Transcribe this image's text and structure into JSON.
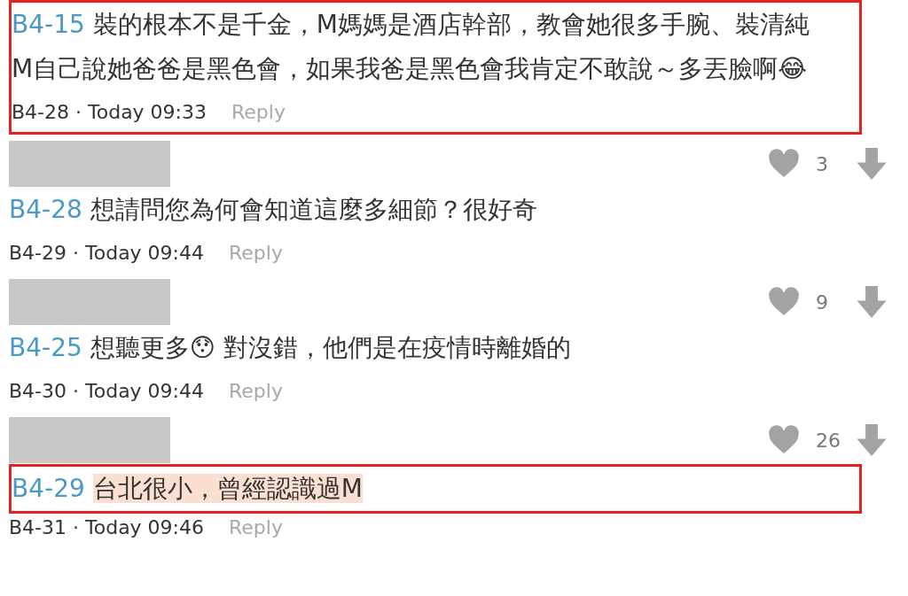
{
  "comments": [
    {
      "kind": "continued",
      "reply_to": "B4-15",
      "text": "裝的根本不是千金，M媽媽是酒店幹部，教會她很多手腕、裝清純\nM自己說她爸爸是黑色會，如果我爸是黑色會我肯定不敢說～多丟臉啊😂",
      "meta": "B4-28 · Today 09:33",
      "reply": "Reply",
      "text_outlined": true,
      "meta_outlined": true,
      "marked": false
    },
    {
      "kind": "full",
      "likes": "3",
      "reply_to": "B4-28",
      "text": "想請問您為何會知道這麼多細節？很好奇",
      "meta": "B4-29 · Today 09:44",
      "reply": "Reply",
      "text_outlined": false,
      "meta_outlined": false,
      "marked": false
    },
    {
      "kind": "full",
      "likes": "9",
      "reply_to": "B4-25",
      "text": "想聽更多😯 對沒錯，他們是在疫情時離婚的",
      "meta": "B4-30 · Today 09:44",
      "reply": "Reply",
      "text_outlined": false,
      "meta_outlined": false,
      "marked": false
    },
    {
      "kind": "full",
      "likes": "26",
      "reply_to": "B4-29",
      "text": "台北很小，曾經認識過M",
      "meta": "B4-31 · Today 09:46",
      "reply": "Reply",
      "text_outlined": true,
      "meta_outlined": false,
      "marked": true
    }
  ]
}
